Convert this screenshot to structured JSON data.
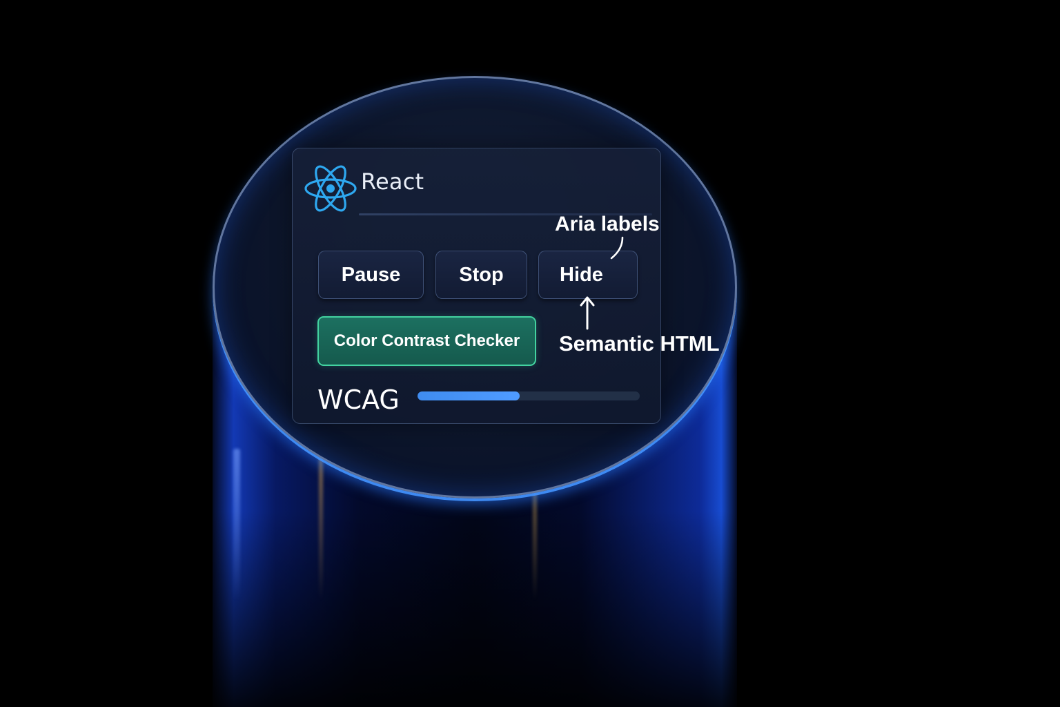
{
  "card": {
    "brand_title": "React",
    "icons": {
      "brand": "react-atom-icon"
    },
    "buttons": {
      "pause_label": "Pause",
      "stop_label": "Stop",
      "hide_label": "Hide",
      "checker_label": "Color Contrast Checker"
    },
    "wcag": {
      "label": "WCAG",
      "progress_fraction": 0.46
    }
  },
  "annotations": {
    "aria": "Aria labels",
    "semantic": "Semantic HTML"
  },
  "colors": {
    "background": "#000000",
    "react_blue": "#2ea8f0",
    "checker_green": "#43d3a0",
    "progress_blue": "#3f8cf0"
  }
}
